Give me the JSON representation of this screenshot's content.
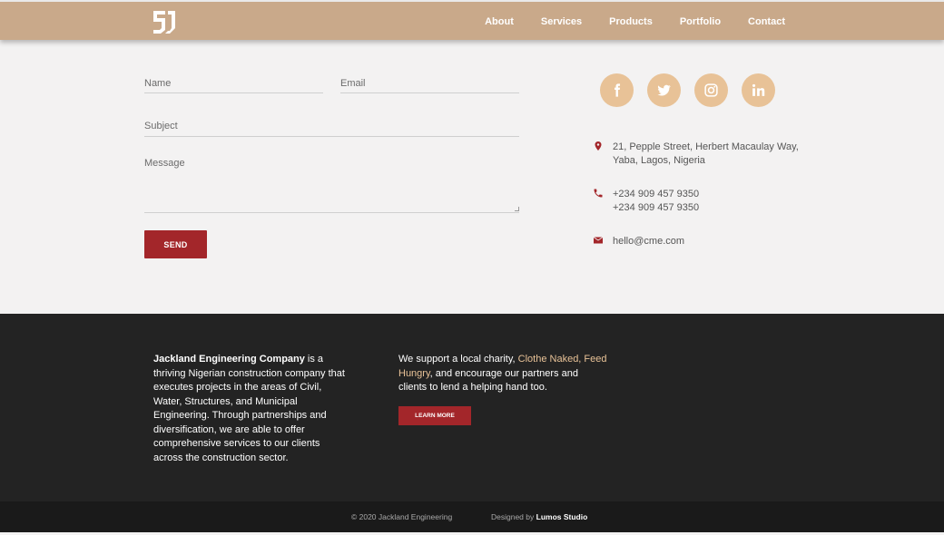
{
  "header": {
    "logo_icon": "jackland-monogram-logo",
    "nav": [
      "About",
      "Services",
      "Products",
      "Portfolio",
      "Contact"
    ],
    "colors": {
      "bar": "#c9a98a",
      "text": "#ffffff"
    }
  },
  "form": {
    "name_label": "Name",
    "email_label": "Email",
    "subject_label": "Subject",
    "message_label": "Message",
    "send_label": "SEND"
  },
  "social": {
    "icons": [
      "facebook-icon",
      "twitter-icon",
      "instagram-icon",
      "linkedin-icon"
    ],
    "color": "#e8c297"
  },
  "contact": {
    "address_line1": "21, Pepple Street, Herbert Macaulay Way,",
    "address_line2": "Yaba, Lagos, Nigeria",
    "phone1": "+234 909 457 9350",
    "phone2": "+234 909 457 9350",
    "email": "hello@cme.com",
    "icon_color": "#a3262a"
  },
  "footer": {
    "company_name": "Jackland Engineering Company",
    "about_text": " is a thriving Nigerian construction company that executes projects in the areas of Civil, Water, Structures, and Municipal Engineering. Through partnerships and diversification, we are able to offer comprehensive services to our clients across the construction sector.",
    "charity_prefix": "We support a local charity, ",
    "charity_name": "Clothe Naked, Feed Hungry",
    "charity_suffix": ", and encourage our partners and clients to lend a helping hand too.",
    "learn_more_label": "LEARN MORE",
    "copyright": "© 2020  Jackland Engineering",
    "designed_by": "Designed by ",
    "studio": "Lumos Studio"
  }
}
